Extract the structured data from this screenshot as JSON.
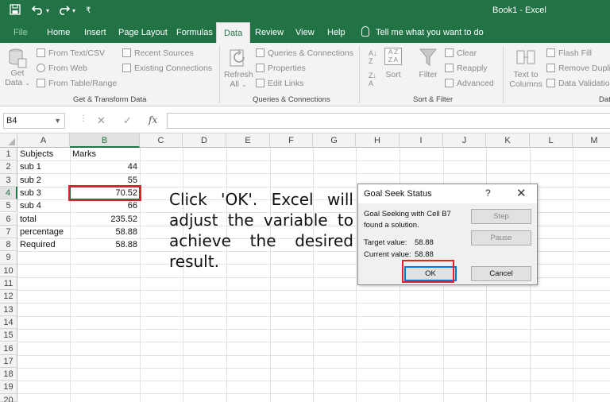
{
  "window": {
    "title": "Book1  -  Excel"
  },
  "quick_access": {
    "save_icon": "save-icon",
    "undo_icon": "undo-icon",
    "redo_icon": "redo-icon"
  },
  "tabs": [
    {
      "label": "File"
    },
    {
      "label": "Home"
    },
    {
      "label": "Insert"
    },
    {
      "label": "Page Layout"
    },
    {
      "label": "Formulas"
    },
    {
      "label": "Data"
    },
    {
      "label": "Review"
    },
    {
      "label": "View"
    },
    {
      "label": "Help"
    }
  ],
  "active_tab": "Data",
  "tell_me": "Tell me what you want to do",
  "ribbon": {
    "get_transform": {
      "get_data": "Get",
      "get_data2": "Data",
      "from_text": "From Text/CSV",
      "from_web": "From Web",
      "from_table": "From Table/Range",
      "recent_sources": "Recent Sources",
      "existing_connections": "Existing Connections",
      "label": "Get & Transform Data"
    },
    "queries": {
      "refresh": "Refresh",
      "refresh_all": "All",
      "queries_connections": "Queries & Connections",
      "properties": "Properties",
      "edit_links": "Edit Links",
      "label": "Queries & Connections"
    },
    "sort_filter": {
      "sort": "Sort",
      "filter": "Filter",
      "clear": "Clear",
      "reapply": "Reapply",
      "advanced": "Advanced",
      "label": "Sort & Filter"
    },
    "data_tools": {
      "text_to": "Text to",
      "columns": "Columns",
      "flash_fill": "Flash Fill",
      "remove_dup": "Remove Duplic",
      "validation": "Data Validatio",
      "label": "Dat"
    }
  },
  "formula_bar": {
    "name_box": "B4",
    "fx": "fx",
    "value": ""
  },
  "columns": [
    "A",
    "B",
    "C",
    "D",
    "E",
    "F",
    "G",
    "H",
    "I",
    "J",
    "K",
    "L",
    "M"
  ],
  "rows": [
    "1",
    "2",
    "3",
    "4",
    "5",
    "6",
    "7",
    "8",
    "9",
    "10",
    "11",
    "12",
    "13",
    "14",
    "15",
    "16",
    "17",
    "18",
    "19",
    "20"
  ],
  "cells": {
    "a1": "Subjects",
    "b1": "Marks",
    "a2": "sub 1",
    "b2": "44",
    "a3": "sub 2",
    "b3": "55",
    "a4": "sub 3",
    "b4": "70.52",
    "a5": "sub 4",
    "b5": "66",
    "a6": "total",
    "b6": "235.52",
    "a7": "percentage",
    "b7": "58.88",
    "a8": "Required",
    "b8": "58.88"
  },
  "annotation": "Click 'OK'. Excel will adjust the variable to achieve the desired result.",
  "dialog": {
    "title": "Goal Seek Status",
    "help": "?",
    "close": "✕",
    "message1": "Goal Seeking with Cell B7",
    "message2": "found a solution.",
    "target_label": "Target value:",
    "target_value": "58.88",
    "current_label": "Current value:",
    "current_value": "58.88",
    "step": "Step",
    "pause": "Pause",
    "ok": "OK",
    "cancel": "Cancel"
  }
}
